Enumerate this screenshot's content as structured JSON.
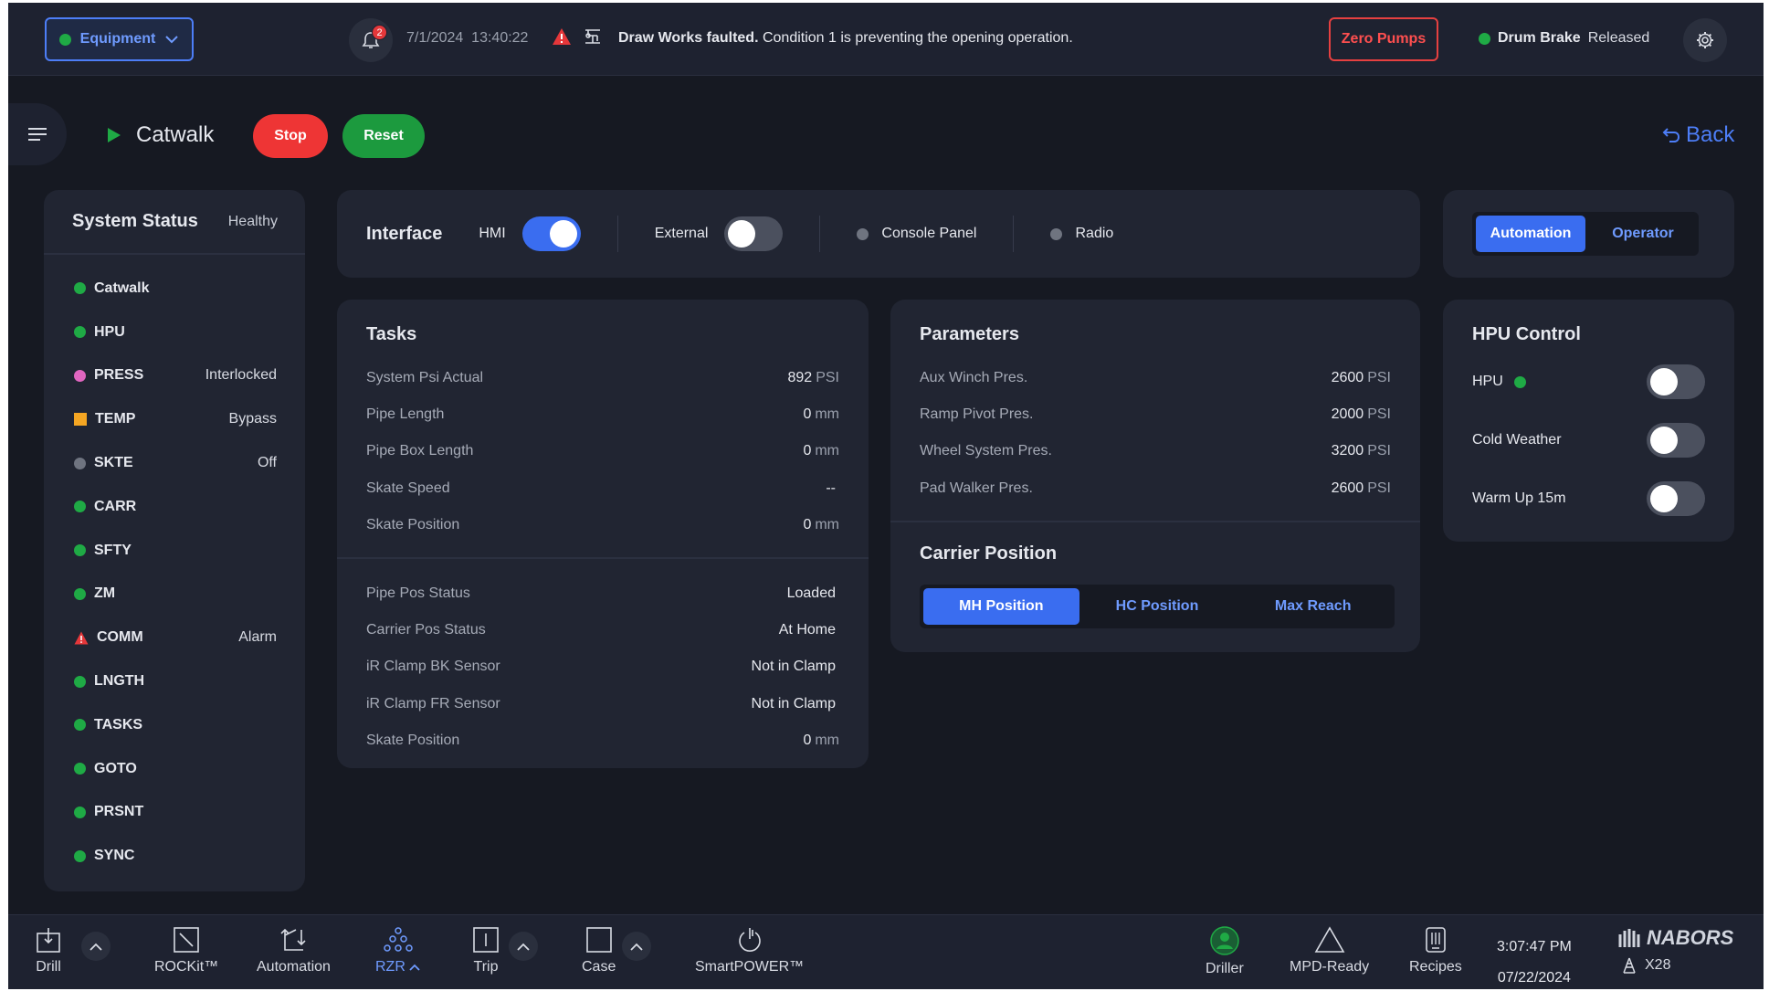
{
  "topbar": {
    "equipment_label": "Equipment",
    "notification_count": "2",
    "date": "7/1/2024",
    "time": "13:40:22",
    "alert_bold": "Draw Works faulted.",
    "alert_text": " Condition 1 is preventing the opening operation.",
    "zero_pumps": "Zero Pumps",
    "drum_brake_label": "Drum Brake",
    "drum_brake_state": "Released"
  },
  "header": {
    "page_title": "Catwalk",
    "stop_label": "Stop",
    "reset_label": "Reset",
    "back_label": "Back"
  },
  "system_status": {
    "title": "System Status",
    "health": "Healthy",
    "items": [
      {
        "name": "Catwalk",
        "state": "",
        "indicator": "green"
      },
      {
        "name": "HPU",
        "state": "",
        "indicator": "green"
      },
      {
        "name": "PRESS",
        "state": "Interlocked",
        "indicator": "pink"
      },
      {
        "name": "TEMP",
        "state": "Bypass",
        "indicator": "orange-square"
      },
      {
        "name": "SKTE",
        "state": "Off",
        "indicator": "grey"
      },
      {
        "name": "CARR",
        "state": "",
        "indicator": "green"
      },
      {
        "name": "SFTY",
        "state": "",
        "indicator": "green"
      },
      {
        "name": "ZM",
        "state": "",
        "indicator": "green"
      },
      {
        "name": "COMM",
        "state": "Alarm",
        "indicator": "warning-icon"
      },
      {
        "name": "LNGTH",
        "state": "",
        "indicator": "green"
      },
      {
        "name": "TASKS",
        "state": "",
        "indicator": "green"
      },
      {
        "name": "GOTO",
        "state": "",
        "indicator": "green"
      },
      {
        "name": "PRSNT",
        "state": "",
        "indicator": "green"
      },
      {
        "name": "SYNC",
        "state": "",
        "indicator": "green"
      }
    ]
  },
  "interface": {
    "title": "Interface",
    "hmi_label": "HMI",
    "hmi_on": true,
    "external_label": "External",
    "external_on": false,
    "console_label": "Console Panel",
    "radio_label": "Radio"
  },
  "mode": {
    "automation_label": "Automation",
    "operator_label": "Operator",
    "selected": "Automation"
  },
  "tasks": {
    "title": "Tasks",
    "group1": [
      {
        "label": "System Psi Actual",
        "value": "892",
        "unit": "PSI"
      },
      {
        "label": "Pipe Length",
        "value": "0",
        "unit": "mm"
      },
      {
        "label": "Pipe Box Length",
        "value": "0",
        "unit": "mm"
      },
      {
        "label": "Skate Speed",
        "value": "--",
        "unit": ""
      },
      {
        "label": "Skate Position",
        "value": "0",
        "unit": "mm"
      }
    ],
    "group2": [
      {
        "label": "Pipe Pos Status",
        "value": "Loaded",
        "unit": ""
      },
      {
        "label": "Carrier Pos Status",
        "value": "At Home",
        "unit": ""
      },
      {
        "label": "iR Clamp BK Sensor",
        "value": "Not in Clamp",
        "unit": ""
      },
      {
        "label": "iR Clamp FR Sensor",
        "value": "Not in Clamp",
        "unit": ""
      },
      {
        "label": "Skate Position",
        "value": "0",
        "unit": "mm"
      }
    ]
  },
  "parameters": {
    "title": "Parameters",
    "items": [
      {
        "label": "Aux Winch Pres.",
        "value": "2600",
        "unit": "PSI"
      },
      {
        "label": "Ramp Pivot Pres.",
        "value": "2000",
        "unit": "PSI"
      },
      {
        "label": "Wheel System Pres.",
        "value": "3200",
        "unit": "PSI"
      },
      {
        "label": "Pad Walker Pres.",
        "value": "2600",
        "unit": "PSI"
      }
    ],
    "carrier_title": "Carrier Position",
    "carrier_options": [
      "MH Position",
      "HC Position",
      "Max Reach"
    ],
    "carrier_selected": "MH Position"
  },
  "hpu_control": {
    "title": "HPU Control",
    "items": [
      {
        "label": "HPU",
        "on": false,
        "status": "green"
      },
      {
        "label": "Cold Weather",
        "on": false
      },
      {
        "label": "Warm Up 15m",
        "on": false
      }
    ]
  },
  "bottombar": {
    "items": [
      {
        "label": "Drill",
        "icon": "drill-icon"
      },
      {
        "label": "ROCKit™",
        "icon": "rockit-icon"
      },
      {
        "label": "Automation",
        "icon": "automation-icon"
      },
      {
        "label": "RZR",
        "icon": "rzr-icon",
        "active": true
      },
      {
        "label": "Trip",
        "icon": "trip-icon"
      },
      {
        "label": "Case",
        "icon": "case-icon"
      },
      {
        "label": "SmartPOWER™",
        "icon": "power-icon"
      },
      {
        "label": "Driller",
        "icon": "user-icon"
      },
      {
        "label": "MPD-Ready",
        "icon": "triangle-icon"
      },
      {
        "label": "Recipes",
        "icon": "recipes-icon"
      }
    ],
    "clock_time": "3:07:47 PM",
    "clock_date": "07/22/2024",
    "brand": "NABORS",
    "rig": "X28"
  },
  "colors": {
    "accent": "#3a6df0",
    "ok": "#1faa45",
    "danger": "#ee3535",
    "warn": "#f5a623",
    "background": "#161922",
    "panel": "#212532"
  }
}
